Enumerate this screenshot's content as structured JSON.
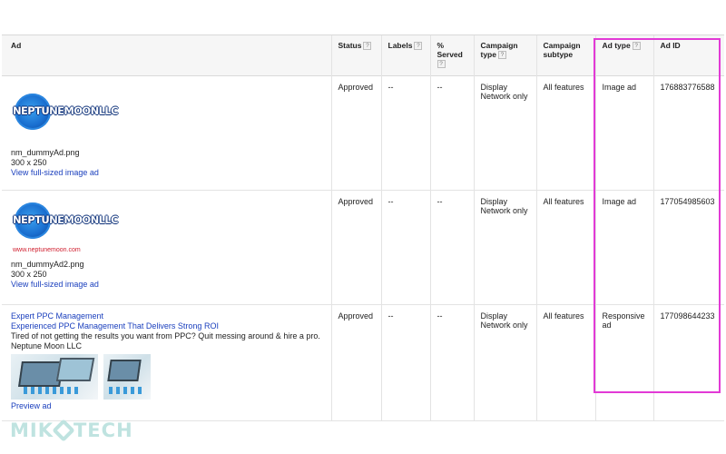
{
  "columns": {
    "ad": "Ad",
    "status": "Status",
    "labels": "Labels",
    "served_1": "%",
    "served_2": "Served",
    "campaign_type_1": "Campaign",
    "campaign_type_2": "type",
    "campaign_subtype_1": "Campaign",
    "campaign_subtype_2": "subtype",
    "ad_type": "Ad type",
    "ad_id": "Ad ID",
    "help_glyph": "?"
  },
  "rows": [
    {
      "logo_text": "NEPTUNEMOONLLC",
      "logo_url": "",
      "file_name": "nm_dummyAd.png",
      "dimensions": "300 x 250",
      "link": "View full-sized image ad",
      "status": "Approved",
      "labels": "--",
      "served": "--",
      "campaign_type": "Display Network only",
      "campaign_subtype": "All features",
      "ad_type": "Image ad",
      "ad_id": "176883776588"
    },
    {
      "logo_text": "NEPTUNEMOONLLC",
      "logo_url": "www.neptunemoon.com",
      "file_name": "nm_dummyAd2.png",
      "dimensions": "300 x 250",
      "link": "View full-sized image ad",
      "status": "Approved",
      "labels": "--",
      "served": "--",
      "campaign_type": "Display Network only",
      "campaign_subtype": "All features",
      "ad_type": "Image ad",
      "ad_id": "177054985603"
    },
    {
      "headline_1": "Expert PPC Management",
      "headline_2": "Experienced PPC Management That Delivers Strong ROI",
      "description": "Tired of not getting the results you want from PPC? Quit messing around & hire a pro.",
      "business": "Neptune Moon LLC",
      "link": "Preview ad",
      "status": "Approved",
      "labels": "--",
      "served": "--",
      "campaign_type": "Display Network only",
      "campaign_subtype": "All features",
      "ad_type": "Responsive ad",
      "ad_id": "177098644233"
    }
  ],
  "watermark": {
    "left": "MIK",
    "right": "TECH"
  },
  "colors": {
    "highlight": "#e23ad6",
    "link": "#1a3fbd",
    "watermark": "#bfe3e0"
  },
  "icons": {
    "help": "question-mark-box-icon",
    "logo": "neptune-moon-logo",
    "thumbnail": "laptop-dashboard-thumbnail"
  }
}
